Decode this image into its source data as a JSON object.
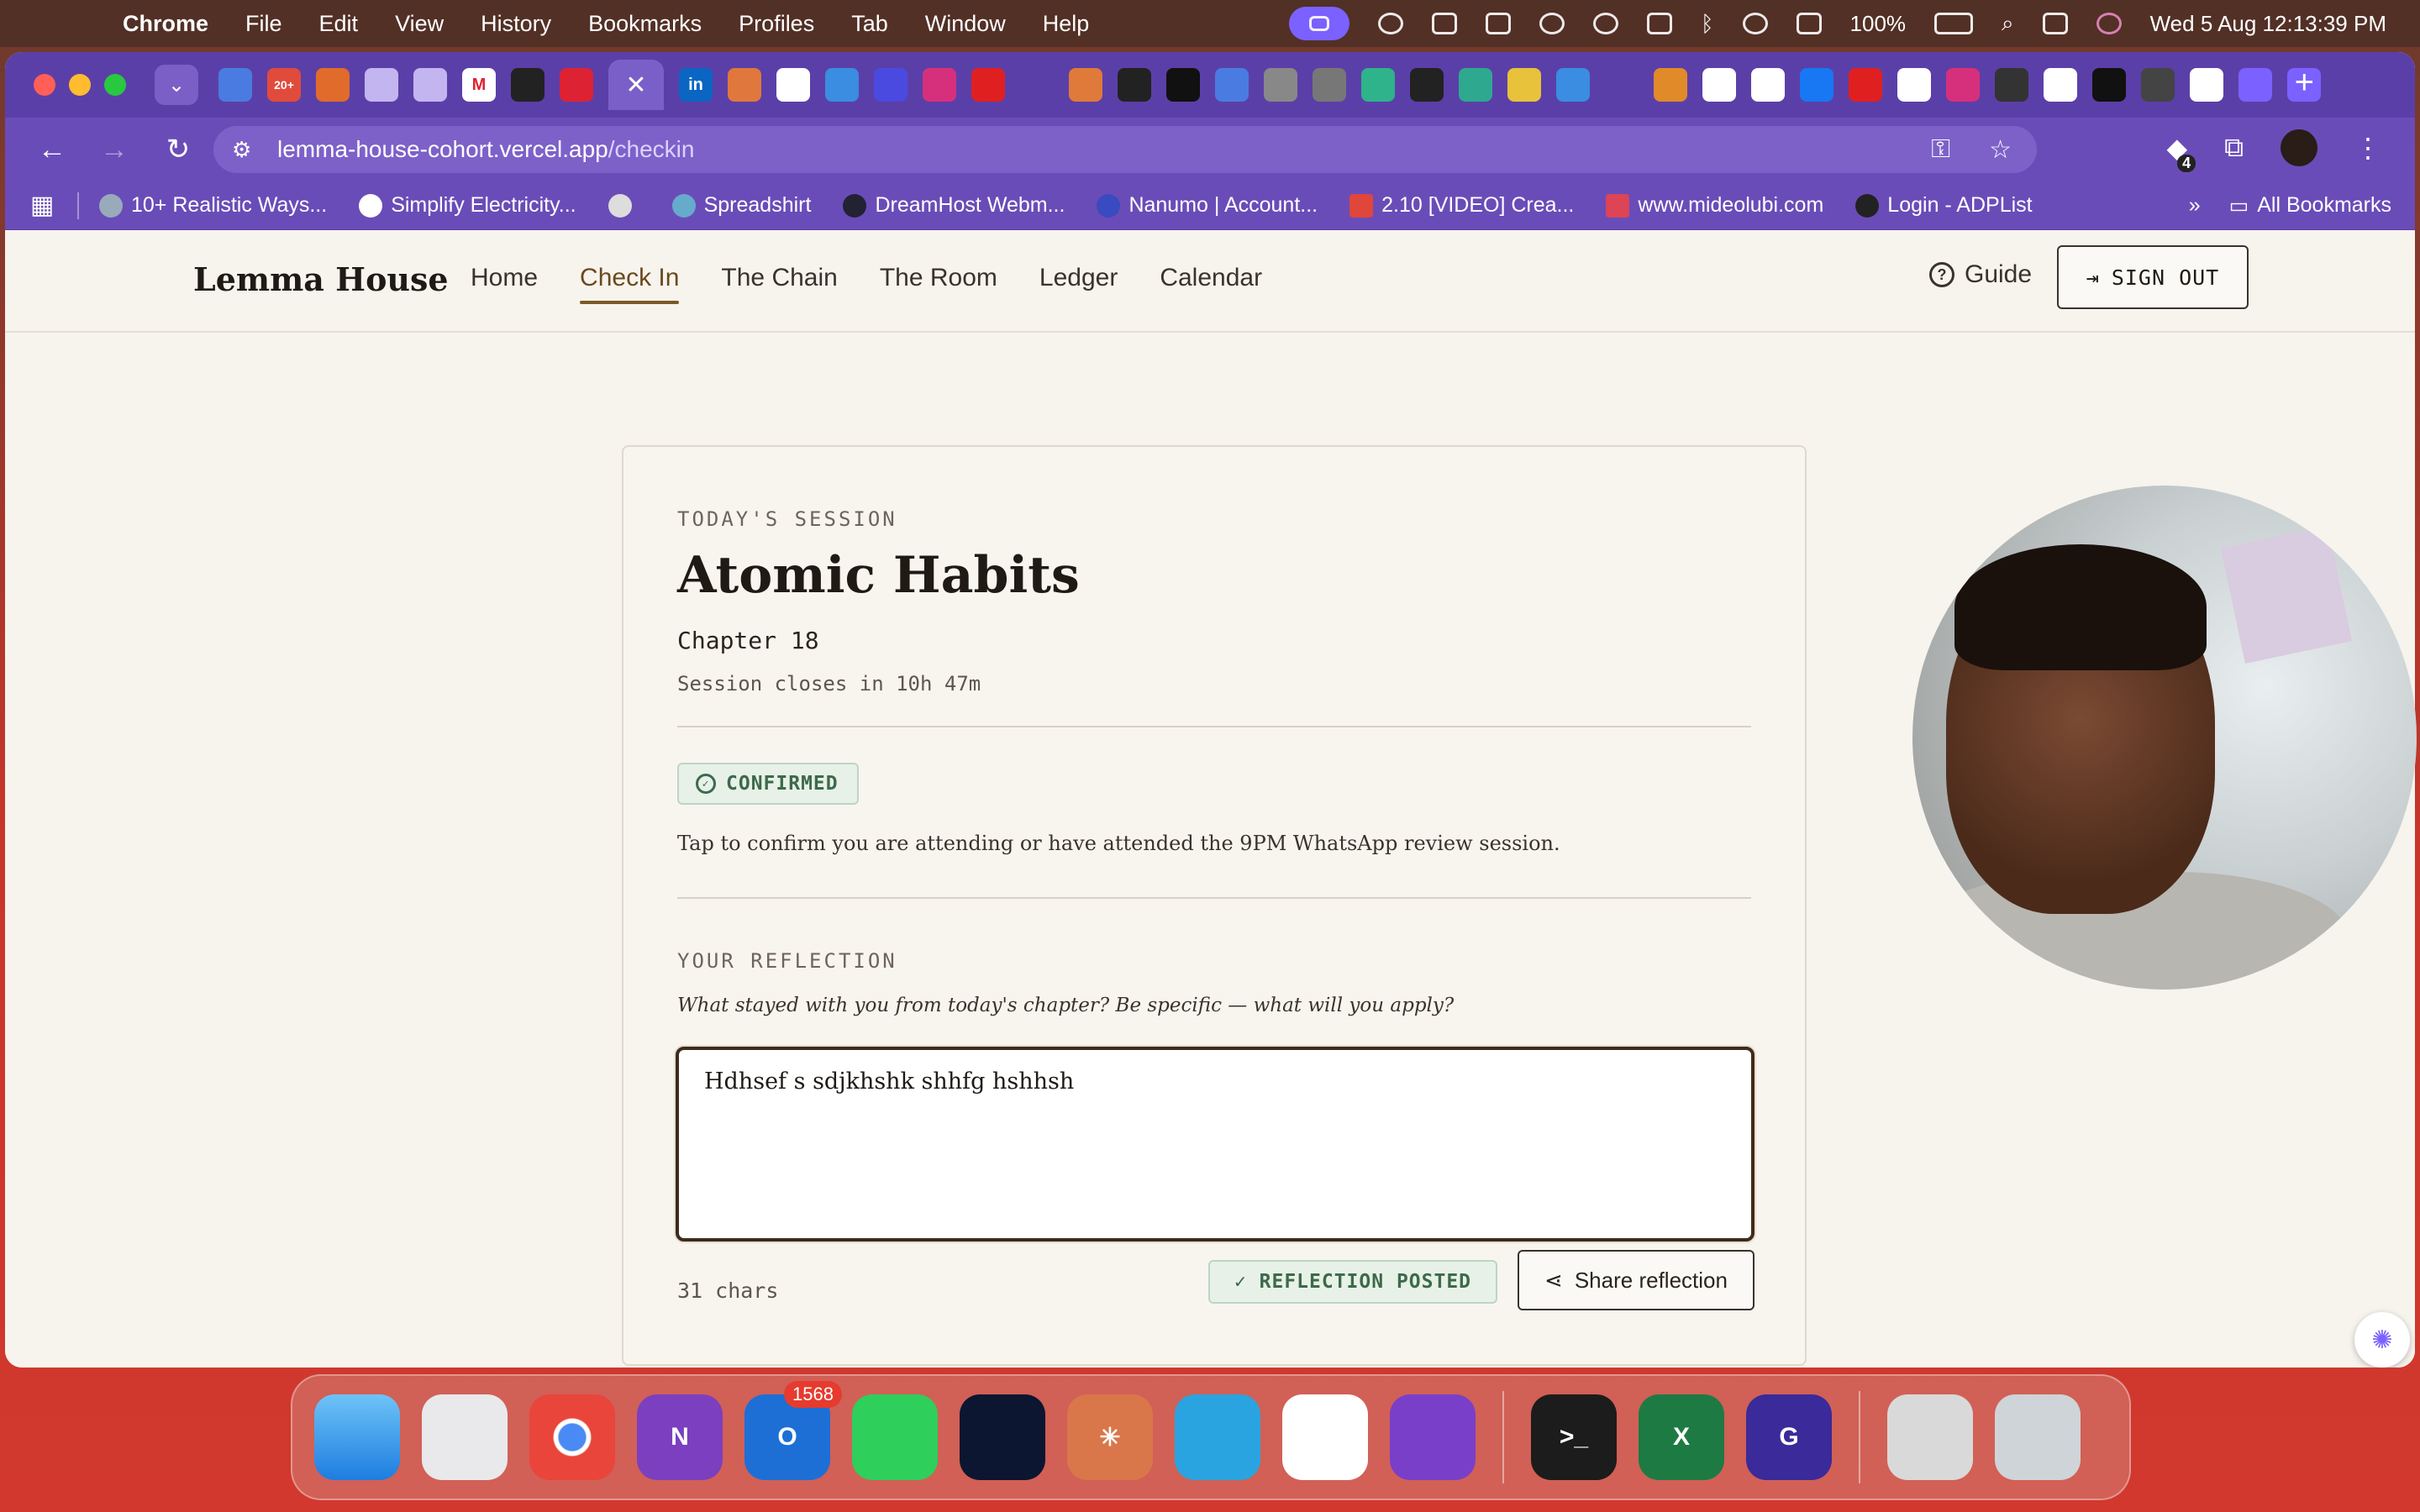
{
  "menubar": {
    "app_name": "Chrome",
    "menus": [
      "File",
      "Edit",
      "View",
      "History",
      "Bookmarks",
      "Profiles",
      "Tab",
      "Window",
      "Help"
    ],
    "battery": "100%",
    "datetime": "Wed 5 Aug  12:13:39 PM"
  },
  "browser": {
    "tab_count_badge": "20+",
    "url_host": "lemma-house-cohort.vercel.app",
    "url_path": "/checkin",
    "extensions_badge": "4",
    "bookmarks": [
      "10+ Realistic Ways...",
      "Simplify Electricity...",
      "",
      "Spreadshirt",
      "DreamHost Webm...",
      "Nanumo | Account...",
      "2.10 [VIDEO] Crea...",
      "www.mideolubi.com",
      "Login - ADPList"
    ],
    "all_bookmarks": "All Bookmarks"
  },
  "site": {
    "brand": "Lemma House",
    "nav": [
      "Home",
      "Check In",
      "The Chain",
      "The Room",
      "Ledger",
      "Calendar"
    ],
    "active_nav": "Check In",
    "guide": "Guide",
    "sign_out": "SIGN OUT"
  },
  "session": {
    "kicker": "TODAY'S SESSION",
    "book_title": "Atomic Habits",
    "chapter": "Chapter 18",
    "closes": "Session closes in 10h 47m",
    "confirmed_label": "CONFIRMED",
    "confirm_note": "Tap to confirm you are attending or have attended the 9PM WhatsApp review session."
  },
  "reflection": {
    "heading": "YOUR REFLECTION",
    "prompt": "What stayed with you from today's chapter? Be specific — what will you apply?",
    "value": "Hdhsef s sdjkhshk shhfg hshhsh",
    "char_count": "31 chars",
    "posted_label": "✓ REFLECTION POSTED",
    "share_label": "Share reflection"
  },
  "dock": {
    "outlook_badge": "1568"
  },
  "colors": {
    "chrome_purple": "#6a4cb8",
    "page_bg": "#f7f4ee",
    "accent_brown": "#7a5a25",
    "success_green": "#3d6a4a"
  }
}
